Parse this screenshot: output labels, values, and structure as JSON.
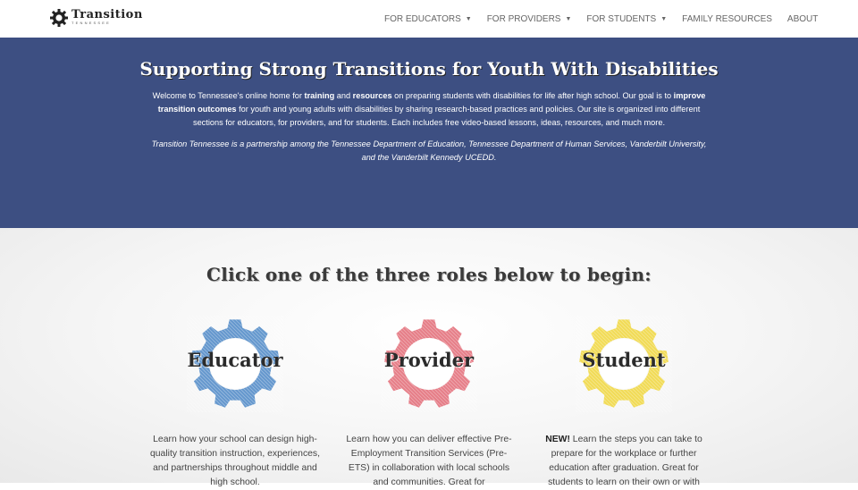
{
  "header": {
    "logo_text": "Transition",
    "logo_subtext": "TENNESSEE",
    "nav": [
      {
        "label": "FOR EDUCATORS",
        "has_dropdown": true
      },
      {
        "label": "FOR PROVIDERS",
        "has_dropdown": true
      },
      {
        "label": "FOR STUDENTS",
        "has_dropdown": true
      },
      {
        "label": "FAMILY RESOURCES",
        "has_dropdown": false
      },
      {
        "label": "ABOUT",
        "has_dropdown": false
      }
    ]
  },
  "hero": {
    "title": "Supporting Strong Transitions for Youth With Disabilities",
    "intro_parts": [
      "Welcome to Tennessee's online home for ",
      "training",
      " and ",
      "resources",
      " on preparing students with disabilities for life after high school. Our goal is to ",
      "improve transition outcomes",
      " for youth and young adults with disabilities by sharing research-based practices and policies. Our site is organized into different sections for educators, for providers, and for students. Each includes free video-based lessons, ideas, resources, and much more."
    ],
    "partner_text": "Transition Tennessee is a partnership among the Tennessee Department of Education, Tennessee Department of Human Services, Vanderbilt University, and the Vanderbilt Kennedy UCEDD."
  },
  "roles": {
    "heading": "Click one of the three roles below to begin:",
    "items": [
      {
        "label": "Educator",
        "color": "#4a86c5",
        "desc_prefix": "",
        "desc": "Learn how your school can design high-quality transition instruction, experiences, and partnerships throughout middle and high school."
      },
      {
        "label": "Provider",
        "color": "#e26773",
        "desc_prefix": "",
        "desc": "Learn how you can deliver effective Pre-Employment Transition Services (Pre-ETS) in collaboration with local schools and communities. Great for"
      },
      {
        "label": "Student",
        "color": "#f0d63a",
        "desc_prefix": "NEW!",
        "desc": " Learn the steps you can take to prepare for the workplace or further education after graduation. Great for students to learn on their own or with"
      }
    ]
  }
}
